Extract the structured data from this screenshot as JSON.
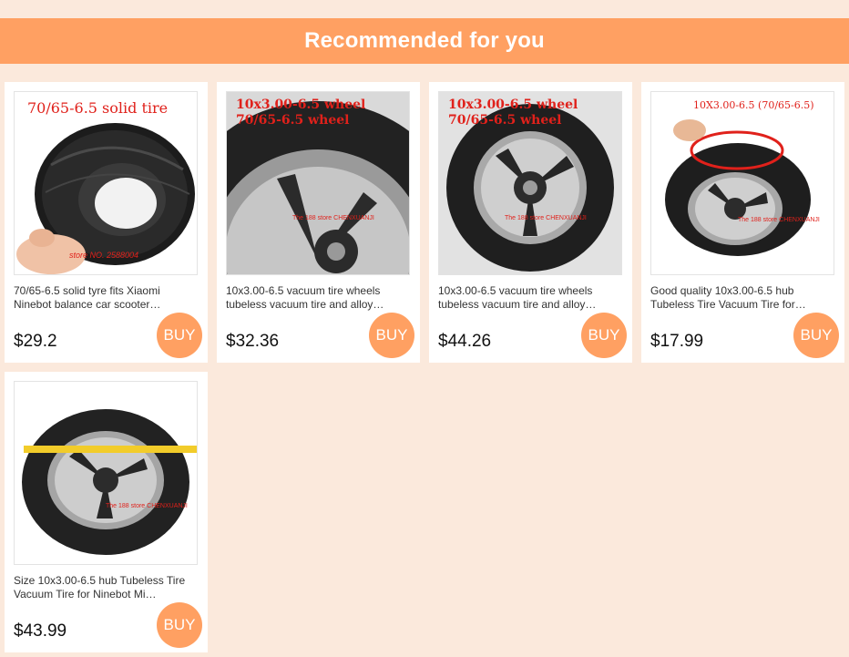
{
  "banner": {
    "title": "Recommended for you"
  },
  "colors": {
    "accent": "#ffa062",
    "page_bg": "#fbe9dc"
  },
  "products": [
    {
      "title": "70/65-6.5 solid tyre fits Xiaomi Ninebot balance car scooter…",
      "price": "$29.2",
      "buy_label": "BUY",
      "image": {
        "caption_lines": [
          "70/65-6.5 solid tire"
        ],
        "watermark": "store NO. 2588004"
      }
    },
    {
      "title": "10x3.00-6.5 vacuum tire wheels tubeless vacuum tire and alloy…",
      "price": "$32.36",
      "buy_label": "BUY",
      "image": {
        "caption_lines": [
          "10x3.00-6.5 wheel",
          "70/65-6.5 wheel"
        ],
        "watermark": "The 188 store CHENXUANJI"
      }
    },
    {
      "title": "10x3.00-6.5 vacuum tire wheels tubeless vacuum tire and alloy…",
      "price": "$44.26",
      "buy_label": "BUY",
      "image": {
        "caption_lines": [
          "10x3.00-6.5 wheel",
          "70/65-6.5 wheel"
        ],
        "watermark": "The 188 store CHENXUANJI"
      }
    },
    {
      "title": "Good quality 10x3.00-6.5 hub Tubeless Tire Vacuum Tire for…",
      "price": "$17.99",
      "buy_label": "BUY",
      "image": {
        "caption_lines": [
          "10X3.00-6.5 (70/65-6.5)"
        ],
        "watermark": "The 188 store CHENXUANJI"
      }
    },
    {
      "title": "Size 10x3.00-6.5 hub Tubeless Tire Vacuum Tire for Ninebot Mi…",
      "price": "$43.99",
      "buy_label": "BUY",
      "image": {
        "caption_lines": [],
        "watermark": "The 188 store CHENXUANJI"
      }
    }
  ]
}
